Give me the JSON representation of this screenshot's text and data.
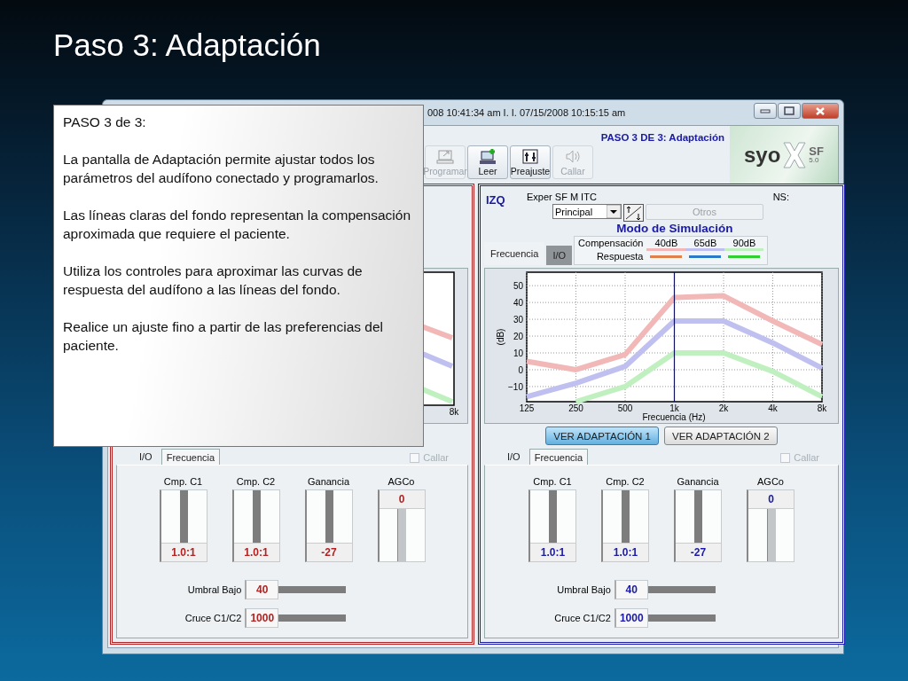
{
  "slide_title": "Paso 3: Adaptación",
  "window": {
    "title": "008 10:41:34 am I. I. 07/15/2008 10:15:15 am",
    "step_label": "PASO 3 DE 3: Adaptación",
    "toolbar": [
      {
        "kind": "program",
        "label": "Programar",
        "disabled": true
      },
      {
        "kind": "read",
        "label": "Leer",
        "disabled": false
      },
      {
        "kind": "preset",
        "label": "Preajuste",
        "disabled": false
      },
      {
        "kind": "mute",
        "label": "Callar",
        "disabled": true
      }
    ],
    "logo": {
      "brand": "syo",
      "superscript": "SF",
      "version": "5.0"
    },
    "panels": [
      {
        "kind": "partial",
        "color": "#b22222",
        "chart_edge_label": "8k",
        "bottom_tabs": [
          {
            "label": "I/O",
            "selected": true
          },
          {
            "label": "Frecuencia",
            "selected": false
          }
        ],
        "mute": {
          "label": "Callar",
          "checked": false,
          "disabled": true
        },
        "vertical_controls": [
          {
            "kind": "value_bottom",
            "label": "Cmp. C1",
            "value": "1.0:1"
          },
          {
            "kind": "value_bottom",
            "label": "Cmp. C2",
            "value": "1.0:1"
          },
          {
            "kind": "value_bottom",
            "label": "Ganancia",
            "value": "-27"
          },
          {
            "kind": "value_top",
            "label": "AGCo",
            "value": "0"
          }
        ],
        "horizontal_controls": [
          {
            "label": "Umbral Bajo",
            "value": "40"
          },
          {
            "label": "Cruce C1/C2",
            "value": "1000"
          }
        ]
      },
      {
        "kind": "full",
        "color": "#1a1aa6",
        "side": "IZQ",
        "device": "Exper SF M ITC",
        "serial_label": "NS:",
        "program_select": "Principal",
        "others_button": {
          "label": "Otros",
          "disabled": true
        },
        "mode_title": "Modo de Simulación",
        "chart_tabs": [
          {
            "label": "Frecuencia",
            "selected": true
          },
          {
            "label": "I/O",
            "selected": false
          }
        ],
        "legend_rows": [
          "Compensación",
          "Respuesta"
        ],
        "response_lines": [
          {
            "color": "#e0804a"
          },
          {
            "color": "#2a7ac8"
          },
          {
            "color": "#30d030"
          }
        ],
        "chart_data": {
          "type": "line",
          "xlabel": "Frecuencia (Hz)",
          "ylabel": "(dB)",
          "categories": [
            "125",
            "250",
            "500",
            "1k",
            "2k",
            "4k",
            "8k"
          ],
          "ylim": [
            -19,
            58
          ],
          "yticks": [
            -10,
            0,
            10,
            20,
            30,
            40,
            50
          ],
          "grid": true,
          "series": [
            {
              "name": "40dB",
              "color": "#f2b8b8",
              "values": [
                5,
                0,
                9,
                43,
                44,
                29,
                15
              ]
            },
            {
              "name": "65dB",
              "color": "#c0c0f0",
              "values": [
                -16,
                -8,
                2,
                29,
                29,
                16,
                1
              ]
            },
            {
              "name": "90dB",
              "color": "#c0f0c0",
              "values": [
                null,
                -19,
                -10,
                10,
                10,
                -1,
                -16
              ]
            }
          ],
          "ref_lines": [
            {
              "axis": "x",
              "value": "1k",
              "color": "#101060"
            }
          ]
        },
        "view_buttons": [
          {
            "label": "VER ADAPTACIÓN 1",
            "selected": true
          },
          {
            "label": "VER ADAPTACIÓN 2",
            "selected": false
          }
        ],
        "bottom_tabs": [
          {
            "label": "I/O",
            "selected": true
          },
          {
            "label": "Frecuencia",
            "selected": false
          }
        ],
        "mute": {
          "label": "Callar",
          "checked": false,
          "disabled": true
        },
        "vertical_controls": [
          {
            "kind": "value_bottom",
            "label": "Cmp. C1",
            "value": "1.0:1"
          },
          {
            "kind": "value_bottom",
            "label": "Cmp. C2",
            "value": "1.0:1"
          },
          {
            "kind": "value_bottom",
            "label": "Ganancia",
            "value": "-27"
          },
          {
            "kind": "value_top",
            "label": "AGCo",
            "value": "0"
          }
        ],
        "horizontal_controls": [
          {
            "label": "Umbral Bajo",
            "value": "40"
          },
          {
            "label": "Cruce C1/C2",
            "value": "1000"
          }
        ]
      }
    ]
  },
  "callout": {
    "heading": "PASO 3 de 3:",
    "paragraphs": [
      "La pantalla de Adaptación permite ajustar todos los parámetros del audífono conectado y programarlos.",
      "Las líneas claras del fondo representan la compensación aproximada que requiere el paciente.",
      "Utiliza los controles para aproximar las curvas de respuesta del audífono a las líneas del fondo.",
      "Realice un ajuste fino a partir de las preferencias del paciente."
    ]
  }
}
